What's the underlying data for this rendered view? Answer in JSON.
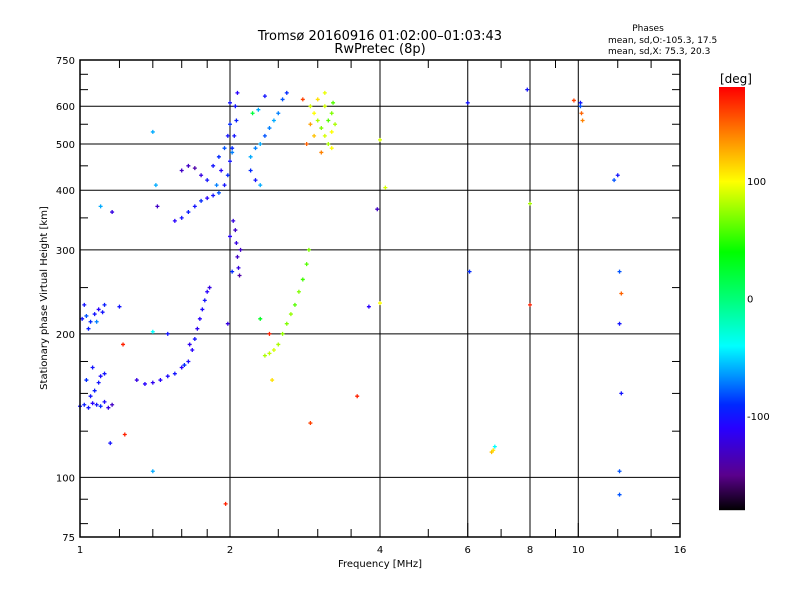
{
  "chart_data": {
    "type": "scatter",
    "title": "Tromsø 20160916 01:02:00–01:03:43",
    "subtitle": "RwPretec (8p)",
    "xlabel": "Frequency [MHz]",
    "ylabel": "Stationary phase Virtual Height [km]",
    "xscale": "log",
    "yscale": "log",
    "xlim": [
      1,
      16
    ],
    "ylim": [
      75,
      750
    ],
    "xticks": [
      1,
      2,
      4,
      6,
      8,
      10,
      16
    ],
    "xgrid": [
      2,
      4,
      6,
      8,
      10
    ],
    "yticks": [
      75,
      100,
      200,
      300,
      400,
      500,
      600,
      750
    ],
    "ygrid": [
      100,
      200,
      300,
      400,
      500,
      600
    ],
    "grid": true,
    "stats": {
      "title": "Phases",
      "line_o": "mean, sd,O:-105.3, 17.5",
      "line_x": "mean, sd,X:  75.3, 20.3"
    },
    "colorbar": {
      "label": "[deg]",
      "range": [
        -180,
        180
      ],
      "ticks": [
        100,
        0,
        -100
      ]
    },
    "point_format": [
      "frequency_MHz",
      "height_km",
      "phase_deg"
    ],
    "points": [
      [
        1.0,
        141,
        -100
      ],
      [
        1.02,
        142,
        -95
      ],
      [
        1.04,
        140,
        -100
      ],
      [
        1.06,
        143,
        -110
      ],
      [
        1.08,
        142,
        -100
      ],
      [
        1.1,
        141,
        -90
      ],
      [
        1.12,
        144,
        -105
      ],
      [
        1.14,
        140,
        -120
      ],
      [
        1.05,
        148,
        -100
      ],
      [
        1.07,
        152,
        -95
      ],
      [
        1.09,
        158,
        -100
      ],
      [
        1.1,
        163,
        -105
      ],
      [
        1.12,
        165,
        -100
      ],
      [
        1.03,
        160,
        -90
      ],
      [
        1.06,
        170,
        -100
      ],
      [
        1.16,
        142,
        -130
      ],
      [
        1.01,
        215,
        -100
      ],
      [
        1.03,
        218,
        -80
      ],
      [
        1.05,
        212,
        -90
      ],
      [
        1.07,
        220,
        -100
      ],
      [
        1.09,
        225,
        -110
      ],
      [
        1.02,
        230,
        -100
      ],
      [
        1.08,
        212,
        -70
      ],
      [
        1.11,
        222,
        -100
      ],
      [
        1.04,
        205,
        -95
      ],
      [
        1.12,
        230,
        -95
      ],
      [
        1.2,
        228,
        -100
      ],
      [
        1.22,
        190,
        170
      ],
      [
        1.15,
        118,
        -100
      ],
      [
        1.23,
        123,
        170
      ],
      [
        1.4,
        103,
        -60
      ],
      [
        1.4,
        530,
        -60
      ],
      [
        1.42,
        410,
        -60
      ],
      [
        1.43,
        370,
        -130
      ],
      [
        1.1,
        370,
        -60
      ],
      [
        1.16,
        360,
        -120
      ],
      [
        1.4,
        202,
        -40
      ],
      [
        1.5,
        200,
        -100
      ],
      [
        1.3,
        160,
        -120
      ],
      [
        1.35,
        157,
        -110
      ],
      [
        1.4,
        158,
        -115
      ],
      [
        1.45,
        160,
        -110
      ],
      [
        1.5,
        163,
        -105
      ],
      [
        1.55,
        165,
        -100
      ],
      [
        1.6,
        170,
        -110
      ],
      [
        1.65,
        175,
        -105
      ],
      [
        1.68,
        185,
        -110
      ],
      [
        1.7,
        195,
        -100
      ],
      [
        1.72,
        205,
        -115
      ],
      [
        1.74,
        215,
        -110
      ],
      [
        1.76,
        225,
        -105
      ],
      [
        1.78,
        235,
        -100
      ],
      [
        1.8,
        245,
        -110
      ],
      [
        1.82,
        250,
        -120
      ],
      [
        1.62,
        172,
        -90
      ],
      [
        1.66,
        190,
        -115
      ],
      [
        1.55,
        345,
        -110
      ],
      [
        1.6,
        350,
        -100
      ],
      [
        1.65,
        360,
        -95
      ],
      [
        1.7,
        370,
        -100
      ],
      [
        1.75,
        380,
        -90
      ],
      [
        1.8,
        385,
        -110
      ],
      [
        1.85,
        390,
        -100
      ],
      [
        1.9,
        395,
        -80
      ],
      [
        1.95,
        410,
        -100
      ],
      [
        1.98,
        430,
        -90
      ],
      [
        2.0,
        460,
        -100
      ],
      [
        2.02,
        490,
        -90
      ],
      [
        2.04,
        520,
        -100
      ],
      [
        2.06,
        560,
        -95
      ],
      [
        2.05,
        600,
        -100
      ],
      [
        2.07,
        640,
        -110
      ],
      [
        1.6,
        440,
        -130
      ],
      [
        1.65,
        450,
        -130
      ],
      [
        1.7,
        445,
        -140
      ],
      [
        1.75,
        430,
        -120
      ],
      [
        1.8,
        420,
        -100
      ],
      [
        1.85,
        450,
        -100
      ],
      [
        1.9,
        470,
        -90
      ],
      [
        1.95,
        490,
        -80
      ],
      [
        1.98,
        520,
        -100
      ],
      [
        2.0,
        550,
        -90
      ],
      [
        2.0,
        610,
        -100
      ],
      [
        2.02,
        480,
        -70
      ],
      [
        1.92,
        440,
        -110
      ],
      [
        1.88,
        410,
        -70
      ],
      [
        2.05,
        330,
        -130
      ],
      [
        2.06,
        310,
        -120
      ],
      [
        2.07,
        290,
        -130
      ],
      [
        2.08,
        275,
        -120
      ],
      [
        2.09,
        265,
        -140
      ],
      [
        2.03,
        345,
        -120
      ],
      [
        2.1,
        300,
        -130
      ],
      [
        2.0,
        320,
        -110
      ],
      [
        1.98,
        210,
        -120
      ],
      [
        2.02,
        270,
        -90
      ],
      [
        2.2,
        470,
        -60
      ],
      [
        2.25,
        490,
        -70
      ],
      [
        2.3,
        500,
        -60
      ],
      [
        2.35,
        520,
        -80
      ],
      [
        2.4,
        540,
        -70
      ],
      [
        2.45,
        560,
        -60
      ],
      [
        2.5,
        580,
        -70
      ],
      [
        2.55,
        620,
        -80
      ],
      [
        2.6,
        640,
        -90
      ],
      [
        2.2,
        440,
        -90
      ],
      [
        2.25,
        420,
        -100
      ],
      [
        2.3,
        410,
        -60
      ],
      [
        2.28,
        590,
        -60
      ],
      [
        2.35,
        630,
        -100
      ],
      [
        2.22,
        580,
        20
      ],
      [
        2.9,
        600,
        90
      ],
      [
        2.95,
        580,
        100
      ],
      [
        3.0,
        560,
        80
      ],
      [
        3.05,
        540,
        70
      ],
      [
        3.1,
        520,
        90
      ],
      [
        3.15,
        500,
        80
      ],
      [
        3.2,
        490,
        100
      ],
      [
        3.0,
        620,
        110
      ],
      [
        3.1,
        600,
        90
      ],
      [
        3.2,
        580,
        70
      ],
      [
        3.25,
        550,
        80
      ],
      [
        3.15,
        560,
        60
      ],
      [
        2.85,
        500,
        150
      ],
      [
        2.95,
        520,
        120
      ],
      [
        3.05,
        480,
        140
      ],
      [
        3.2,
        530,
        100
      ],
      [
        2.9,
        550,
        130
      ],
      [
        3.1,
        640,
        95
      ],
      [
        2.8,
        620,
        160
      ],
      [
        3.22,
        610,
        60
      ],
      [
        2.35,
        180,
        80
      ],
      [
        2.4,
        182,
        85
      ],
      [
        2.45,
        185,
        90
      ],
      [
        2.5,
        190,
        80
      ],
      [
        2.55,
        200,
        75
      ],
      [
        2.6,
        210,
        70
      ],
      [
        2.65,
        220,
        75
      ],
      [
        2.7,
        230,
        60
      ],
      [
        2.75,
        245,
        70
      ],
      [
        2.8,
        260,
        55
      ],
      [
        2.85,
        280,
        60
      ],
      [
        2.88,
        300,
        70
      ],
      [
        2.3,
        215,
        30
      ],
      [
        2.4,
        200,
        170
      ],
      [
        2.43,
        160,
        110
      ],
      [
        3.6,
        148,
        170
      ],
      [
        3.8,
        228,
        -110
      ],
      [
        3.95,
        365,
        -130
      ],
      [
        4.0,
        510,
        90
      ],
      [
        4.1,
        405,
        90
      ],
      [
        2.9,
        130,
        160
      ],
      [
        4.0,
        232,
        100
      ],
      [
        6.0,
        610,
        -100
      ],
      [
        6.05,
        270,
        -90
      ],
      [
        6.7,
        113,
        120
      ],
      [
        6.75,
        114,
        110
      ],
      [
        6.8,
        116,
        -40
      ],
      [
        7.9,
        650,
        -100
      ],
      [
        8.0,
        375,
        80
      ],
      [
        8.0,
        230,
        170
      ],
      [
        9.8,
        617,
        160
      ],
      [
        10.1,
        610,
        -100
      ],
      [
        10.15,
        580,
        150
      ],
      [
        10.2,
        560,
        140
      ],
      [
        10.1,
        600,
        -80
      ],
      [
        12.0,
        430,
        -100
      ],
      [
        11.8,
        420,
        -80
      ],
      [
        12.1,
        270,
        -80
      ],
      [
        12.2,
        243,
        150
      ],
      [
        12.1,
        210,
        -100
      ],
      [
        12.2,
        150,
        -100
      ],
      [
        12.1,
        103,
        -80
      ],
      [
        12.1,
        92,
        -80
      ],
      [
        1.96,
        88,
        170
      ]
    ]
  }
}
